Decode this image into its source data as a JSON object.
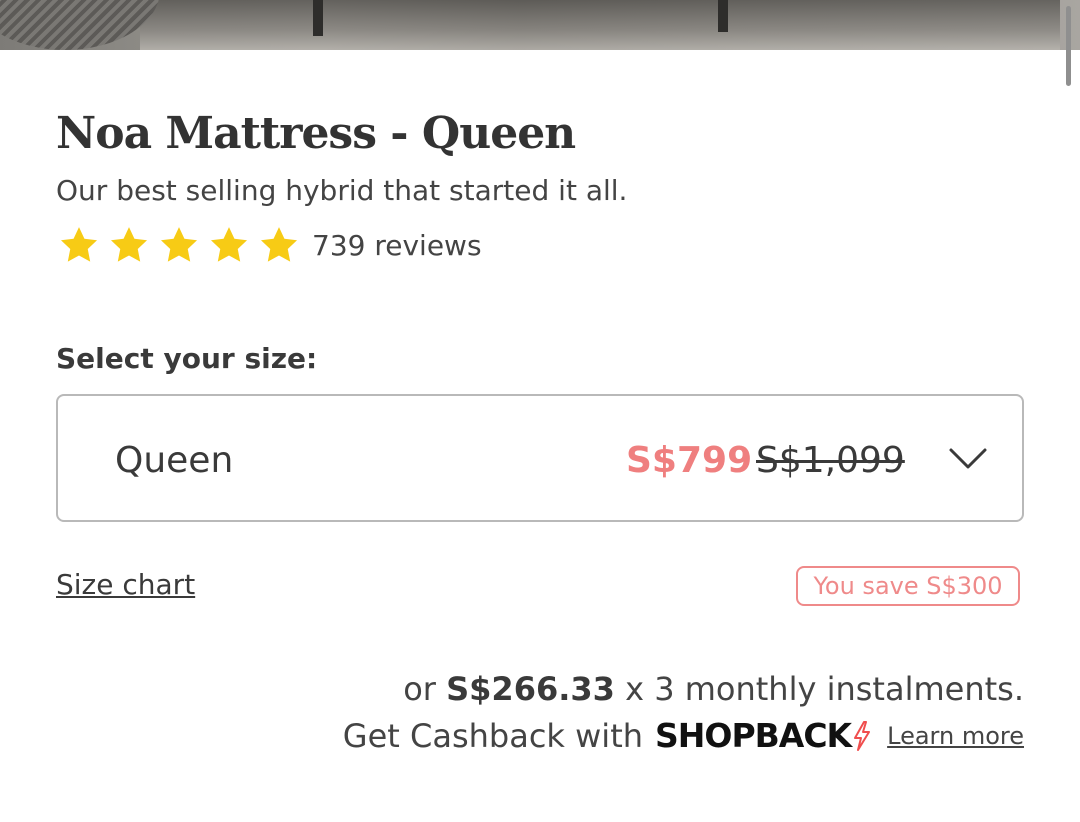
{
  "product": {
    "title": "Noa Mattress - Queen",
    "subtitle": "Our best selling hybrid that started it all.",
    "rating_stars": 5,
    "reviews_text": "739 reviews"
  },
  "size_selector": {
    "label": "Select your size:",
    "selected_value": "Queen",
    "price_now": "S$799",
    "price_old": "S$1,099"
  },
  "links": {
    "size_chart": "Size chart",
    "learn_more": "Learn more"
  },
  "badge": {
    "savings": "You save S$300"
  },
  "instalment": {
    "prefix": "or",
    "amount": "S$266.33",
    "suffix": "x 3 monthly instalments."
  },
  "cashback": {
    "text": "Get Cashback with",
    "brand": "SHOPBACK"
  },
  "icons": {
    "star": "star-icon",
    "chevron": "chevron-down-icon",
    "bolt": "shopback-bolt-icon"
  },
  "colors": {
    "star": "#F7CB15",
    "sale_price": "#EF7F7F",
    "badge": "#EF8A8A",
    "brand_bolt": "#F04E4E"
  }
}
